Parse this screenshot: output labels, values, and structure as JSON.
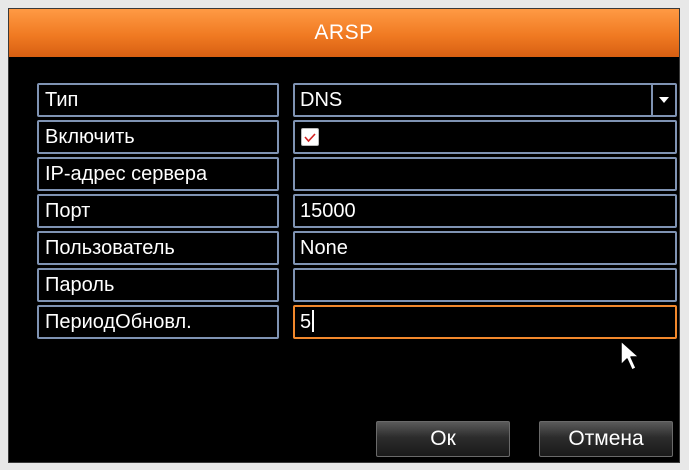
{
  "dialog": {
    "title": "ARSP"
  },
  "form": {
    "rows": [
      {
        "label": "Тип",
        "value": "DNS",
        "control": "select"
      },
      {
        "label": "Включить",
        "value": "",
        "control": "checkbox",
        "checked": true
      },
      {
        "label": "IP-адрес сервера",
        "value": "",
        "control": "text"
      },
      {
        "label": "Порт",
        "value": "15000",
        "control": "text"
      },
      {
        "label": "Пользователь",
        "value": "None",
        "control": "text"
      },
      {
        "label": "Пароль",
        "value": "",
        "control": "password"
      },
      {
        "label": "ПериодОбновл.",
        "value": "5",
        "control": "text",
        "focused": true
      }
    ]
  },
  "buttons": {
    "ok": "Ок",
    "cancel": "Отмена"
  },
  "icons": {
    "dropdown": "chevron-down-icon",
    "check": "checkmark-icon",
    "pointer": "mouse-pointer-icon"
  },
  "colors": {
    "title_bar": "#f07a22",
    "background": "#000000",
    "field_border": "#7f93b3",
    "focus_border": "#f2882c",
    "checkmark": "#d22222",
    "text": "#ffffff"
  }
}
